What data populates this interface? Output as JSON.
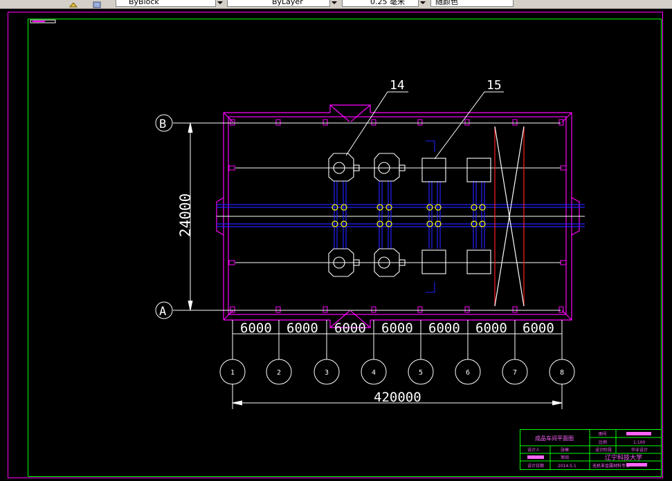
{
  "toolbar": {
    "linetype": "ByBlock",
    "layer": "ByLayer",
    "lineweight": "0.25 毫米",
    "color": "随颜色"
  },
  "drawing": {
    "grid_axes_rows": [
      "B",
      "A"
    ],
    "grid_axes_columns": [
      "1",
      "2",
      "3",
      "4",
      "5",
      "6",
      "7",
      "8"
    ],
    "bay_dimensions": [
      "6000",
      "6000",
      "6000",
      "6000",
      "6000",
      "6000",
      "6000"
    ],
    "total_length": "420000",
    "span_width": "24000",
    "callouts": [
      "14",
      "15"
    ]
  },
  "title_block": {
    "drawing_title": "成品车间平面图",
    "drawing_no_label": "图号",
    "scale_label": "比例",
    "scale_value": "1:100",
    "designer_label": "设计人",
    "designer_name": "张琳",
    "stage_label": "设计阶段",
    "stage_value": "毕业设计",
    "reviewer_label": "审阅",
    "university": "辽宁科技大学",
    "date_label": "设计日期",
    "date_value": "2014.5.1",
    "major": "无机非金属材料专业"
  },
  "colors": {
    "wall": "#ff00ff",
    "frame": "#00ff00",
    "line": "#ffffff",
    "pipe": "#0000ff",
    "valve": "#ffff00",
    "crane": "#ff0000"
  }
}
